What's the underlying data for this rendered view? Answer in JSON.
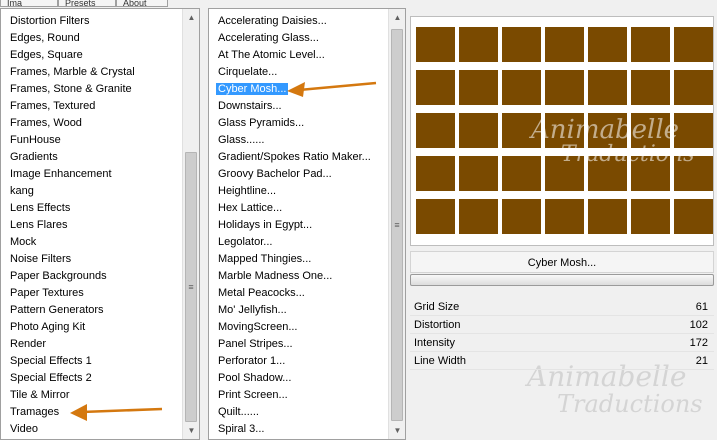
{
  "tabs": [
    "Ima",
    "Presets",
    "About"
  ],
  "left_list": {
    "items": [
      "Distortion Filters",
      "Edges, Round",
      "Edges, Square",
      "Frames, Marble & Crystal",
      "Frames, Stone & Granite",
      "Frames, Textured",
      "Frames, Wood",
      "FunHouse",
      "Gradients",
      "Image Enhancement",
      "kang",
      "Lens Effects",
      "Lens Flares",
      "Mock",
      "Noise Filters",
      "Paper Backgrounds",
      "Paper Textures",
      "Pattern Generators",
      "Photo Aging Kit",
      "Render",
      "Special Effects 1",
      "Special Effects 2",
      "Tile & Mirror",
      "Tramages",
      "Video"
    ],
    "scroll_thumb_glyph": "≡"
  },
  "middle_list": {
    "items": [
      "Accelerating Daisies...",
      "Accelerating Glass...",
      "At The Atomic Level...",
      "Cirquelate...",
      "Cyber Mosh...",
      "Downstairs...",
      "Glass Pyramids...",
      "Glass......",
      "Gradient/Spokes Ratio Maker...",
      "Groovy Bachelor Pad...",
      "Heightline...",
      "Hex Lattice...",
      "Holidays in Egypt...",
      "Legolator...",
      "Mapped Thingies...",
      "Marble Madness One...",
      "Metal Peacocks...",
      "Mo' Jellyfish...",
      "MovingScreen...",
      "Panel Stripes...",
      "Perforator 1...",
      "Pool Shadow...",
      "Print Screen...",
      "Quilt......",
      "Spiral 3..."
    ],
    "selected_index": 4,
    "scroll_thumb_glyph": "≡"
  },
  "preview": {
    "tile_color": "#7a4a00",
    "watermark_line1": "Animabelle",
    "watermark_line2": "Traductions"
  },
  "filter_name": "Cyber Mosh...",
  "params": [
    {
      "name": "Grid Size",
      "value": "61"
    },
    {
      "name": "Distortion",
      "value": "102"
    },
    {
      "name": "Intensity",
      "value": "172"
    },
    {
      "name": "Line Width",
      "value": "21"
    }
  ],
  "colors": {
    "accent": "#3399ff",
    "arrow": "#d4780f"
  }
}
